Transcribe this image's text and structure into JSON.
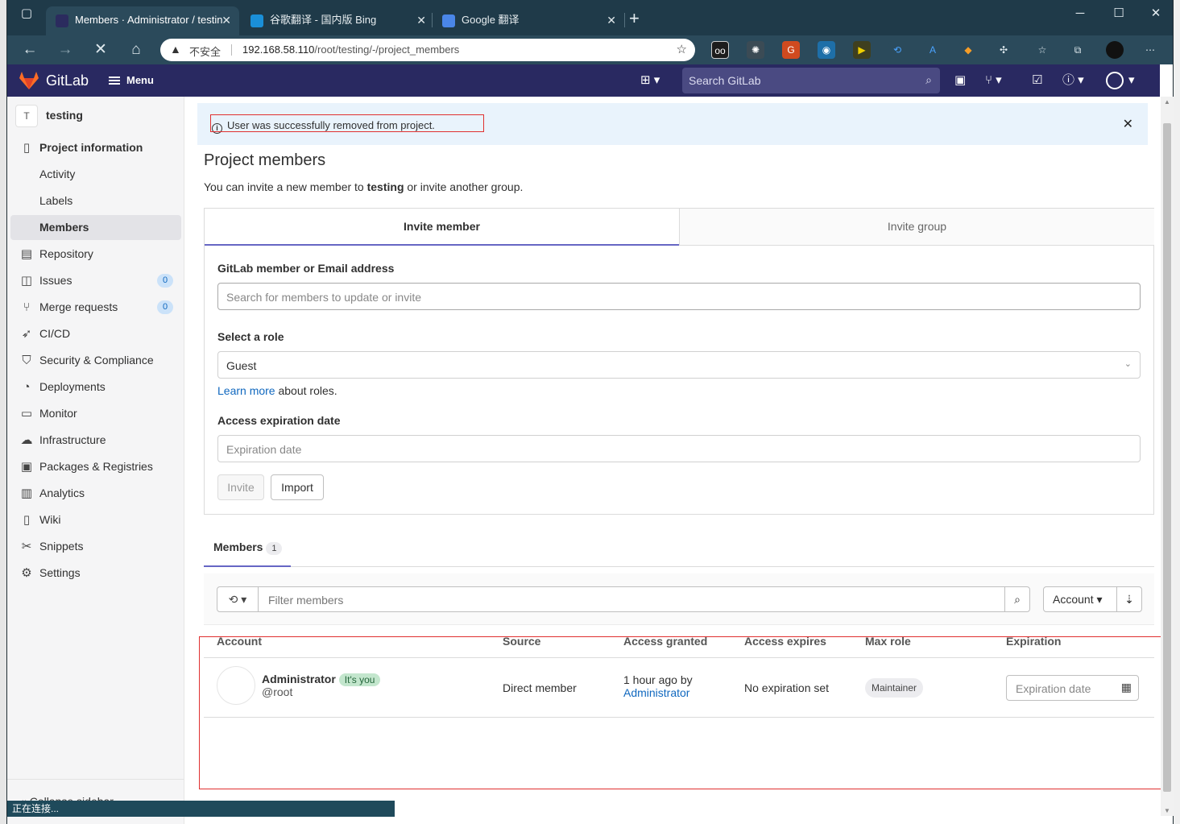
{
  "browser": {
    "tabs": [
      {
        "title": "Members · Administrator / testin",
        "active": true
      },
      {
        "title": "谷歌翻译 - 国内版 Bing",
        "active": false
      },
      {
        "title": "Google 翻译",
        "active": false
      }
    ],
    "security_label": "不安全",
    "url_host": "192.168.58.110",
    "url_path": "/root/testing/-/project_members",
    "status_text": "正在连接..."
  },
  "header": {
    "app_name": "GitLab",
    "menu_label": "Menu",
    "search_placeholder": "Search GitLab",
    "brand_color": "#292961"
  },
  "sidebar": {
    "project_initial": "T",
    "project_name": "testing",
    "items": [
      {
        "label": "Project information",
        "icon": "info-icon"
      },
      {
        "label": "Activity"
      },
      {
        "label": "Labels"
      },
      {
        "label": "Members",
        "active": true
      },
      {
        "label": "Repository",
        "icon": "doc-icon"
      },
      {
        "label": "Issues",
        "icon": "issues-icon",
        "count": "0"
      },
      {
        "label": "Merge requests",
        "icon": "merge-icon",
        "count": "0"
      },
      {
        "label": "CI/CD",
        "icon": "rocket-icon"
      },
      {
        "label": "Security & Compliance",
        "icon": "shield-icon"
      },
      {
        "label": "Deployments",
        "icon": "deploy-icon"
      },
      {
        "label": "Monitor",
        "icon": "monitor-icon"
      },
      {
        "label": "Infrastructure",
        "icon": "cloud-icon"
      },
      {
        "label": "Packages & Registries",
        "icon": "package-icon"
      },
      {
        "label": "Analytics",
        "icon": "chart-icon"
      },
      {
        "label": "Wiki",
        "icon": "book-icon"
      },
      {
        "label": "Snippets",
        "icon": "scissors-icon"
      },
      {
        "label": "Settings",
        "icon": "gear-icon"
      }
    ],
    "collapse_label": "Collapse sidebar"
  },
  "flash": {
    "message": "User was successfully removed from project."
  },
  "page": {
    "title": "Project members",
    "subtitle_prefix": "You can invite a new member to ",
    "subtitle_project": "testing",
    "subtitle_suffix": " or invite another group."
  },
  "invite": {
    "tab_member": "Invite member",
    "tab_group": "Invite group",
    "member_label": "GitLab member or Email address",
    "member_placeholder": "Search for members to update or invite",
    "role_label": "Select a role",
    "role_value": "Guest",
    "learn_more": "Learn more",
    "about_roles": " about roles.",
    "expiration_label": "Access expiration date",
    "expiration_placeholder": "Expiration date",
    "invite_button": "Invite",
    "import_button": "Import"
  },
  "members_tab": {
    "label": "Members",
    "count": "1"
  },
  "filter": {
    "placeholder": "Filter members",
    "sort_label": "Account"
  },
  "table": {
    "columns": [
      "Account",
      "Source",
      "Access granted",
      "Access expires",
      "Max role",
      "Expiration"
    ],
    "rows": [
      {
        "name": "Administrator",
        "badge": "It's you",
        "username": "@root",
        "source": "Direct member",
        "granted_time": "1 hour ago by",
        "granted_by": "Administrator",
        "expires": "No expiration set",
        "max_role": "Maintainer",
        "expiration_placeholder": "Expiration date"
      }
    ]
  }
}
